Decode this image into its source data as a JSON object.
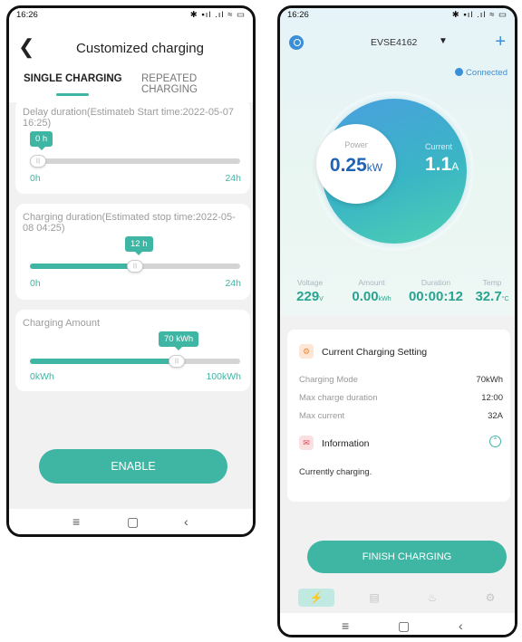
{
  "left_screen": {
    "status_time": "16:26",
    "status_icons": "✱ ▪ıl .ıl ≈ ▭",
    "title": "Customized charging",
    "tabs": [
      "SINGLE CHARGING",
      "REPEATED CHARGING"
    ],
    "active_tab": 0,
    "delay": {
      "label": "Delay duration(Estimateb Start time:2022-05-07 16:25)",
      "bubble": "0 h",
      "value_fraction": 0.0,
      "min": "0h",
      "max": "24h"
    },
    "charging_duration": {
      "label": "Charging duration(Estimated stop time:2022-05-08 04:25)",
      "bubble": "12 h",
      "value_fraction": 0.5,
      "min": "0h",
      "max": "24h"
    },
    "charging_amount": {
      "label": "Charging Amount",
      "bubble": "70 kWh",
      "value_fraction": 0.7,
      "min": "0kWh",
      "max": "100kWh"
    },
    "enable_button": "ENABLE",
    "nav": [
      "≡",
      "▢",
      "‹"
    ]
  },
  "right_screen": {
    "status_time": "16:26",
    "status_icons": "✱ ▪ıl .ıl ≈ ▭",
    "device_name": "EVSE4162",
    "connection": "Connected",
    "power": {
      "label": "Power",
      "value": "0.25",
      "unit": "kW"
    },
    "current": {
      "label": "Current",
      "value": "1.1",
      "unit": "A"
    },
    "stats": [
      {
        "label": "Voltage",
        "value": "229",
        "unit": "V"
      },
      {
        "label": "Amount",
        "value": "0.00",
        "unit": "kWh"
      },
      {
        "label": "Duration",
        "value": "00:00:12",
        "unit": ""
      },
      {
        "label": "Temp",
        "value": "32.7",
        "unit": "°C"
      }
    ],
    "setting_title": "Current Charging Setting",
    "settings": [
      {
        "label": "Charging Mode",
        "value": "70kWh"
      },
      {
        "label": "Max charge duration",
        "value": "12:00"
      },
      {
        "label": "Max current",
        "value": "32A"
      }
    ],
    "info_title": "Information",
    "info_text": "Currently charging.",
    "finish_button": "FINISH CHARGING",
    "nav": [
      "≡",
      "▢",
      "‹"
    ],
    "colors": {
      "accent": "#3fb5a3",
      "blue": "#3b8fd8"
    }
  }
}
